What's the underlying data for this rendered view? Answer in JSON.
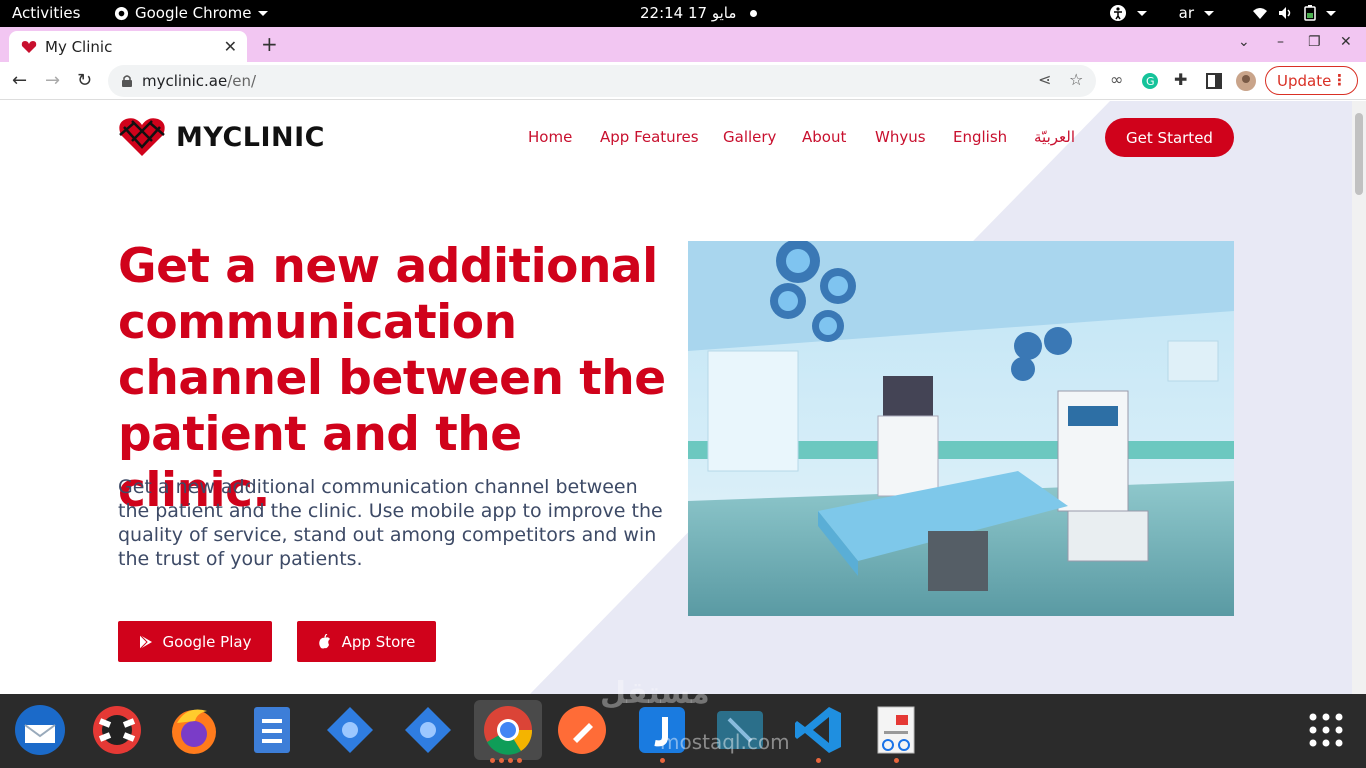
{
  "system_bar": {
    "activities": "Activities",
    "app_name": "Google Chrome",
    "clock": "22:14 17 مايو",
    "language": "ar"
  },
  "browser": {
    "tab_title": "My Clinic",
    "url_host": "myclinic.ae",
    "url_path": "/en/",
    "update_label": "Update"
  },
  "site": {
    "logo_text": "MYCLINIC",
    "nav": [
      "Home",
      "App Features",
      "Gallery",
      "About",
      "Whyus",
      "English",
      "العربيّة"
    ],
    "cta": "Get Started",
    "hero_title": "Get a new additional communication channel between the patient and the clinic.",
    "hero_subtitle": "Get a new additional communication channel between the patient and the clinic. Use mobile app to improve the quality of service, stand out among competitors and win the trust of your patients.",
    "google_play": "Google Play",
    "app_store": "App Store"
  },
  "watermark": {
    "arabic": "مستقل",
    "latin": "mostaql.com"
  },
  "colors": {
    "brand_red": "#d0021b",
    "tab_strip": "#f2c6f2",
    "diag_bg": "#e8e9f5"
  },
  "dock": {
    "items": [
      "thunderbird-icon",
      "help-icon",
      "firefox-icon",
      "files-icon",
      "settings-icon",
      "settings-icon-2",
      "chrome-icon",
      "postman-icon",
      "joplin-icon",
      "app-icon",
      "vscode-icon",
      "document-viewer-icon",
      "show-apps-icon"
    ]
  }
}
